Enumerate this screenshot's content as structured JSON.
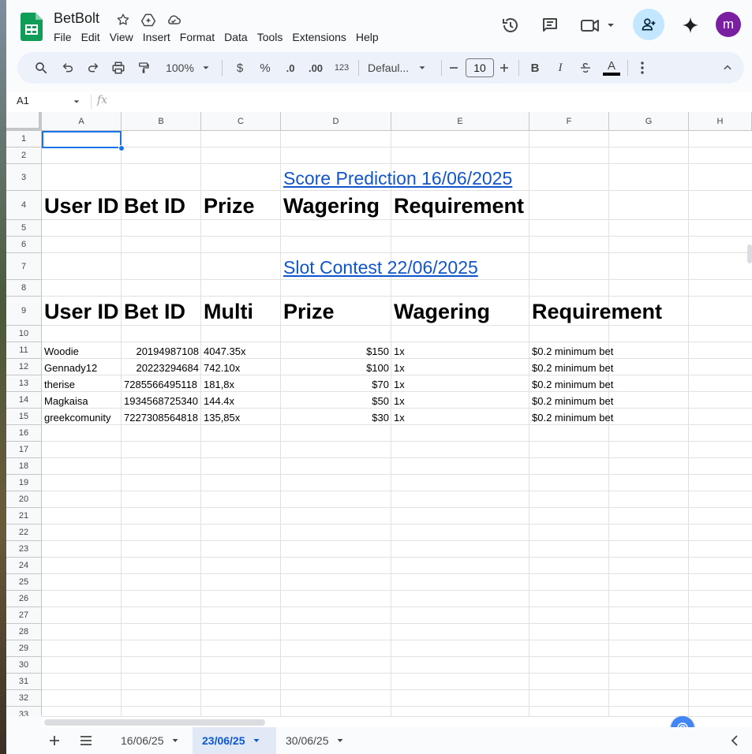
{
  "app": {
    "title": "BetBolt",
    "menu": [
      "File",
      "Edit",
      "View",
      "Insert",
      "Format",
      "Data",
      "Tools",
      "Extensions",
      "Help"
    ],
    "avatar_letter": "m",
    "accent_color": "#0b57d0",
    "avatar_color": "#7b1fa2"
  },
  "toolbar": {
    "zoom": "100%",
    "currency": "$",
    "percent": "%",
    "dec_decrease": ".0",
    "dec_increase": ".00",
    "number_format": "123",
    "font": "Defaul...",
    "font_size": "10",
    "bold": "B",
    "italic": "I",
    "text_color": "A"
  },
  "formula_bar": {
    "name_box": "A1",
    "fx": "fx",
    "value": ""
  },
  "columns": [
    "A",
    "B",
    "C",
    "D",
    "E",
    "F",
    "G",
    "H"
  ],
  "rows": [
    "1",
    "2",
    "3",
    "4",
    "5",
    "6",
    "7",
    "8",
    "9",
    "10",
    "11",
    "12",
    "13",
    "14",
    "15",
    "16",
    "17",
    "18",
    "19",
    "20",
    "21",
    "22",
    "23",
    "24",
    "25",
    "26",
    "27",
    "28",
    "29",
    "30",
    "31",
    "32",
    "33"
  ],
  "sheet": {
    "section1_title": "Score Prediction 16/06/2025",
    "section1_headers": [
      "User ID",
      "Bet ID",
      "Prize",
      "Wagering",
      "Requirement"
    ],
    "section2_title": "Slot Contest 22/06/2025",
    "section2_headers": [
      "User ID",
      "Bet ID",
      "Multi",
      "Prize",
      "Wagering",
      "Requirement"
    ],
    "section2_rows": [
      {
        "user": "Woodie",
        "bet": "20194987108",
        "multi": "4047.35x",
        "prize": "$150",
        "wagering": "1x",
        "req": "$0.2 minimum bet"
      },
      {
        "user": "Gennady12",
        "bet": "20223294684",
        "multi": "742.10x",
        "prize": "$100",
        "wagering": "1x",
        "req": "$0.2 minimum bet"
      },
      {
        "user": "therise",
        "bet": "7285566495118",
        "multi": "181,8x",
        "prize": "$70",
        "wagering": "1x",
        "req": "$0.2 minimum bet"
      },
      {
        "user": "Magkaisa",
        "bet": "1934568725340",
        "multi": "144.4x",
        "prize": "$50",
        "wagering": "1x",
        "req": "$0.2 minimum bet"
      },
      {
        "user": "greekcomunity",
        "bet": "7227308564818",
        "multi": "135,85x",
        "prize": "$30",
        "wagering": "1x",
        "req": "$0.2 minimum bet"
      }
    ]
  },
  "tabs": [
    {
      "label": "16/06/25",
      "active": false
    },
    {
      "label": "23/06/25",
      "active": true
    },
    {
      "label": "30/06/25",
      "active": false
    }
  ]
}
